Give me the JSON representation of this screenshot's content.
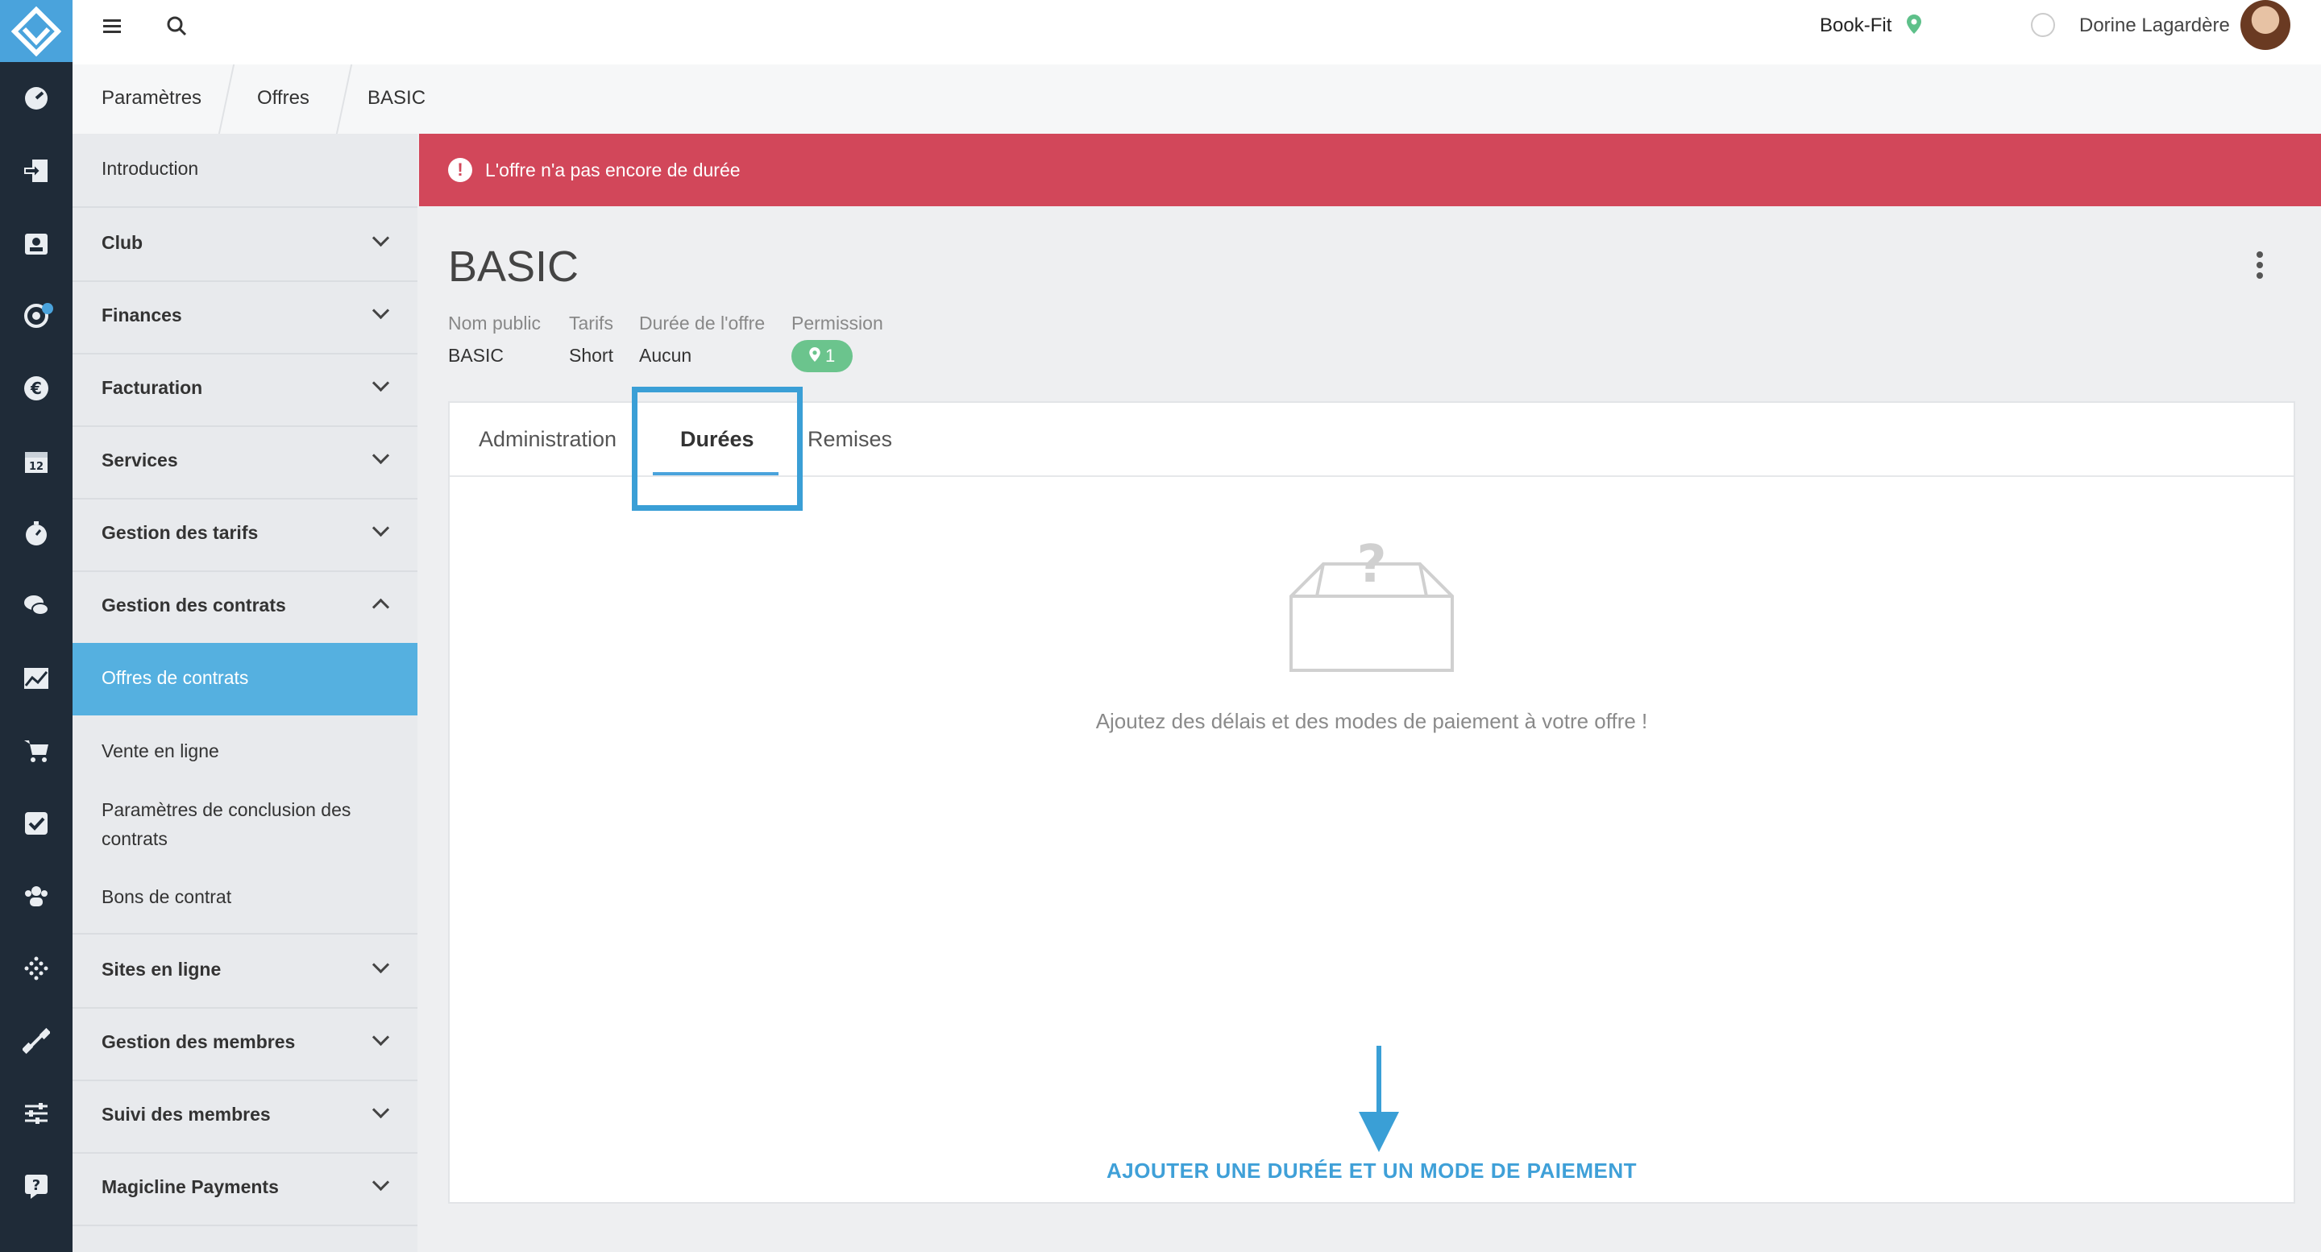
{
  "topbar": {
    "club_name": "Book-Fit",
    "user_name": "Dorine Lagardère"
  },
  "breadcrumb": [
    "Paramètres",
    "Offres",
    "BASIC"
  ],
  "sidebar": {
    "items": [
      {
        "label": "Introduction"
      },
      {
        "label": "Club"
      },
      {
        "label": "Finances"
      },
      {
        "label": "Facturation"
      },
      {
        "label": "Services"
      },
      {
        "label": "Gestion des tarifs"
      },
      {
        "label": "Gestion des contrats"
      },
      {
        "label": "Offres de contrats"
      },
      {
        "label": "Sites en ligne"
      },
      {
        "label": "Gestion des membres"
      },
      {
        "label": "Suivi des membres"
      },
      {
        "label": "Magicline Payments"
      }
    ],
    "subitems": [
      {
        "label": "Vente en ligne"
      },
      {
        "label": "Paramètres de conclusion des contrats"
      },
      {
        "label": "Bons de contrat"
      }
    ]
  },
  "alert": {
    "text": "L'offre n'a pas encore de durée"
  },
  "offer": {
    "title": "BASIC",
    "meta": [
      {
        "label": "Nom public",
        "value": "BASIC"
      },
      {
        "label": "Tarifs",
        "value": "Short"
      },
      {
        "label": "Durée de l'offre",
        "value": "Aucun"
      },
      {
        "label": "Permission",
        "value": "1"
      }
    ]
  },
  "tabs": [
    {
      "label": "Administration"
    },
    {
      "label": "Durées"
    },
    {
      "label": "Remises"
    }
  ],
  "empty_state": {
    "text": "Ajoutez des délais et des modes de paiement à votre offre !",
    "action_label": "AJOUTER UNE DURÉE ET UN MODE DE PAIEMENT"
  },
  "icons": {
    "rail": [
      "logo-icon",
      "dashboard-icon",
      "check-in-icon",
      "contacts-icon",
      "target-icon",
      "euro-icon",
      "calendar-icon",
      "timer-icon",
      "chat-icon",
      "chart-icon",
      "cart-icon",
      "task-icon",
      "group-icon",
      "device-icon",
      "dumbbell-icon",
      "settings-sliders-icon",
      "help-icon"
    ]
  },
  "colors": {
    "accent": "#4aa3dc",
    "alert": "#d2475a",
    "sidebar_active": "#55b0e0",
    "rail": "#1f2b38",
    "badge": "#6bc48d"
  }
}
